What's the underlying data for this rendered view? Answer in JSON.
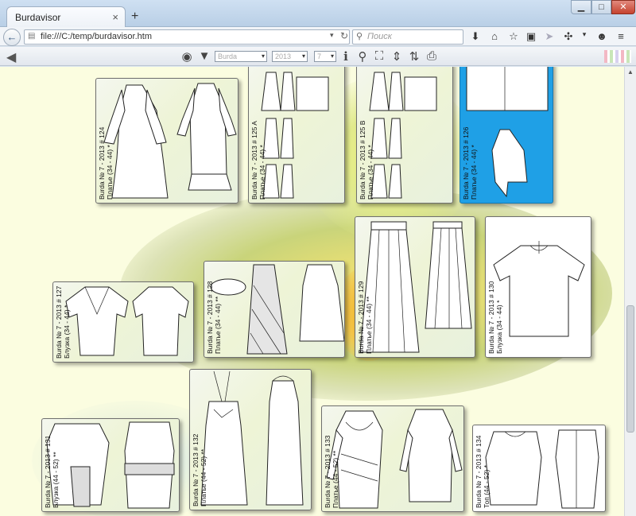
{
  "window": {
    "tab_title": "Burdavisor",
    "tab_close": "×",
    "new_tab": "+",
    "controls": {
      "minimize": "▁",
      "maximize": "□",
      "close": "✕"
    }
  },
  "navbar": {
    "url": "file:///C:/temp/burdavisor.htm",
    "search_placeholder": "Поиск"
  },
  "app_toolbar": {
    "magazine_select": "Burda",
    "year_select": "2013",
    "issue_select": "7"
  },
  "patterns": [
    {
      "magazine": "Burda № 7 - 2013 # 124",
      "type": "Платье (34 - 44) *"
    },
    {
      "magazine": "Burda № 7 - 2013 # 125 A",
      "type": "Платье (34 - 44) *"
    },
    {
      "magazine": "Burda № 7 - 2013 # 125 B",
      "type": "Платье (34 - 44) *"
    },
    {
      "magazine": "Burda № 7 - 2013 # 126",
      "type": "Платье (34 - 44) *"
    },
    {
      "magazine": "Burda № 7 - 2013 # 127",
      "type": "Блузка (34 - 44) *"
    },
    {
      "magazine": "Burda № 7 - 2013 # 128",
      "type": "Платье (34 - 44) **"
    },
    {
      "magazine": "Burda № 7 - 2013 # 129",
      "type": "Платье (34 - 44) **"
    },
    {
      "magazine": "Burda № 7 - 2013 # 130",
      "type": "Блузка (34 - 44) *"
    },
    {
      "magazine": "Burda № 7 - 2013 # 131",
      "type": "Блузка (44 - 52) **"
    },
    {
      "magazine": "Burda № 7 - 2013 # 132",
      "type": "Платье (44 - 52) **"
    },
    {
      "magazine": "Burda № 7 - 2013 # 133",
      "type": "Платье (44 - 52) **"
    },
    {
      "magazine": "Burda № 7 - 2013 # 134",
      "type": "Топ (44 - 52) *"
    }
  ],
  "colors": {
    "selected_card": "#1fa0e6",
    "background": "#fbfde0",
    "tab_red": "#f3d0d4",
    "tab_blue": "#cfd8ef",
    "tab_green": "#cde8c9"
  }
}
